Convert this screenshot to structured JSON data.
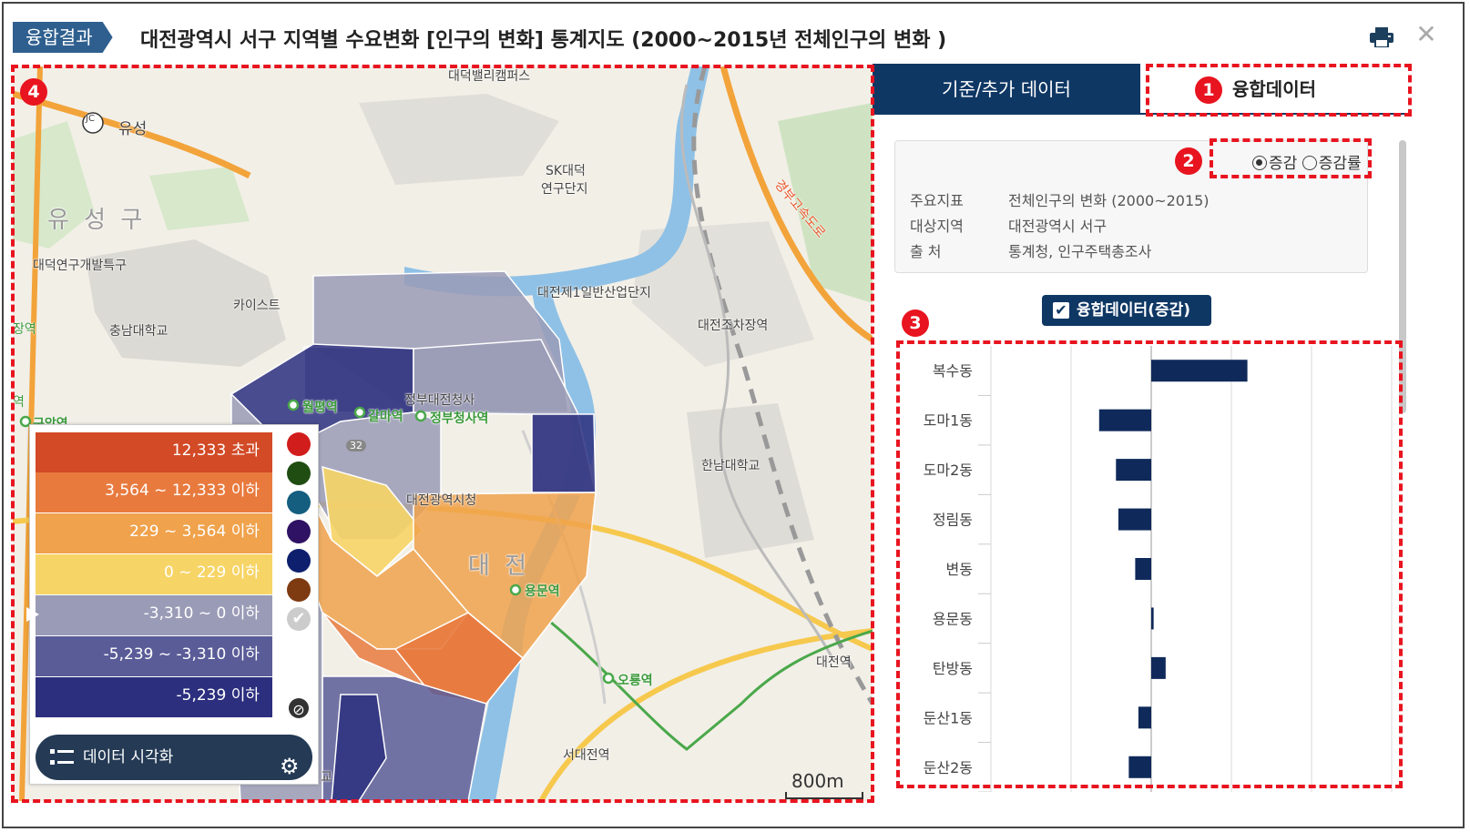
{
  "header": {
    "badge": "융합결과",
    "title": "대전광역시 서구 지역별 수요변화 [인구의 변화] 통계지도 (2000~2015년 전체인구의 변화 )"
  },
  "map": {
    "labels": {
      "campus": "대덕밸리캠퍼스",
      "yuseong": "유성",
      "jc": "JC",
      "sk": "SK대덕",
      "sk2": "연구단지",
      "yuseonggu": "유 성 구",
      "daedeok": "대덕연구개발특구",
      "kaist": "카이스트",
      "cnu": "충남대학교",
      "industrial": "대전제1일반산업단지",
      "jochajang": "대전조차장역",
      "government": "정부대전청사",
      "cityhall": "대전광역시청",
      "daejeon": "대 전",
      "yongmun": "용문역",
      "hannam": "한남대학교",
      "oryong": "오룡역",
      "seodaejeon": "서대전역",
      "daejeonstation": "대전역",
      "gyeongbu": "경부고속도로",
      "wolpyeong": "월평역",
      "galma": "갈마역",
      "jeongbu": "정부청사역",
      "guam": "구암역",
      "station_left": "장역",
      "yeok": "역",
      "gyo": "교",
      "num_32": "32"
    },
    "scale": "800m"
  },
  "legend": {
    "rows": [
      {
        "label": "12,333 초과",
        "color": "#d24a26"
      },
      {
        "label": "3,564 ~ 12,333 이하",
        "color": "#e87a3e"
      },
      {
        "label": "229 ~ 3,564 이하",
        "color": "#f0a24c"
      },
      {
        "label": "0 ~ 229 이하",
        "color": "#f7d466"
      },
      {
        "label": "-3,310 ~ 0 이하",
        "color": "#9a9bb6"
      },
      {
        "label": "-5,239 ~ -3,310 이하",
        "color": "#5a5c98"
      },
      {
        "label": "-5,239 이하",
        "color": "#2c2f7e"
      }
    ],
    "dots": [
      "#d21d1d",
      "#1f4d12",
      "#155e80",
      "#2f1263",
      "#0e1f6e",
      "#7e3a10",
      "#cccccc"
    ],
    "button": "데이터 시각화"
  },
  "panel": {
    "tabs": {
      "base": "기준/추가 데이터",
      "fusion": "융합데이터"
    },
    "radio": {
      "option1": "증감",
      "option2": "증감률"
    },
    "info": [
      {
        "key": "주요지표",
        "value": "전체인구의 변화 (2000~2015)"
      },
      {
        "key": "대상지역",
        "value": "대전광역시 서구"
      },
      {
        "key": "출    처",
        "value": "통계청, 인구주택총조사"
      }
    ],
    "toggle": "융합데이터(증감)"
  },
  "annotations": [
    "1",
    "2",
    "3",
    "4"
  ],
  "chart_data": {
    "type": "bar",
    "orientation": "horizontal",
    "categories": [
      "복수동",
      "도마1동",
      "도마2동",
      "정림동",
      "변동",
      "용문동",
      "탄방동",
      "둔산1동",
      "둔산2동"
    ],
    "values": [
      12000,
      -6500,
      -4400,
      -4100,
      -2000,
      300,
      1800,
      -1600,
      -2800
    ],
    "xlim": [
      -20000,
      30000
    ],
    "color": "#0f2a5a",
    "grid": true
  }
}
